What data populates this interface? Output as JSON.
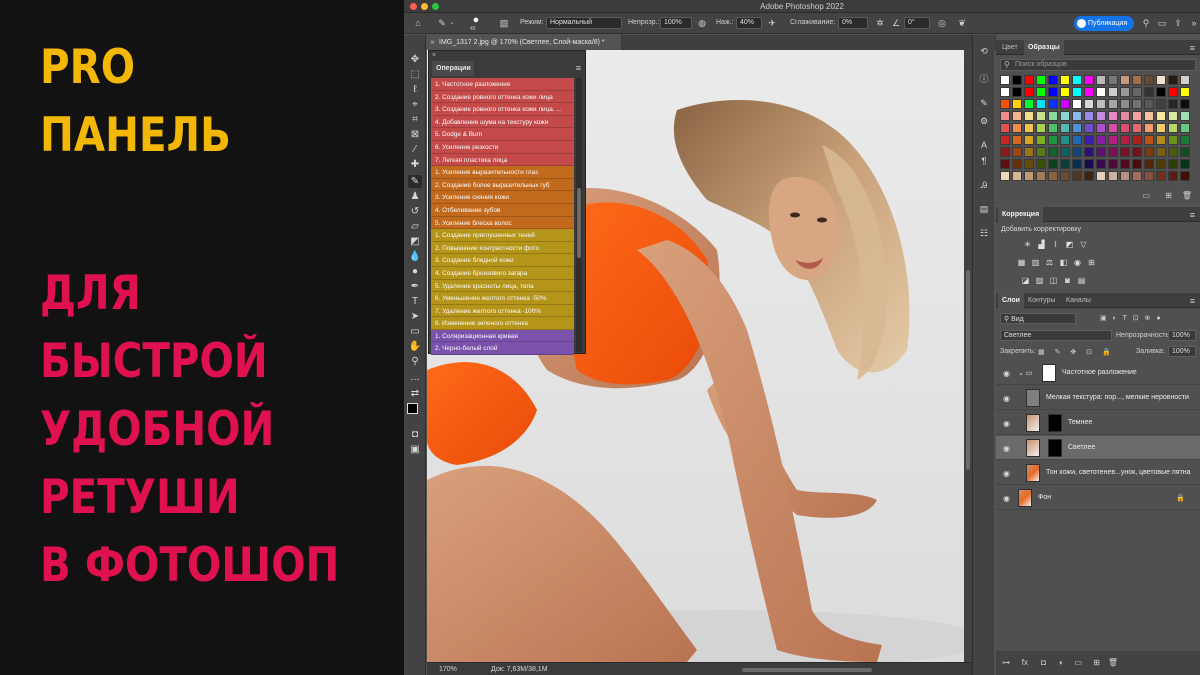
{
  "promo": {
    "line1": "PRO",
    "line2": "ПАНЕЛЬ",
    "line3": "ДЛЯ",
    "line4": "БЫСТРОЙ",
    "line5": "УДОБНОЙ",
    "line6": "РЕТУШИ",
    "line7": "В ФОТОШОП",
    "colors": {
      "yellow": "#f2b707",
      "pink": "#e0114f",
      "background": "#121212"
    }
  },
  "window": {
    "title": "Adobe Photoshop 2022"
  },
  "options_bar": {
    "brush_size": "45",
    "mode_label": "Режим:",
    "mode_value": "Нормальный",
    "opacity_label": "Непрозр.:",
    "opacity_value": "100%",
    "pressure_label": "Наж.:",
    "pressure_value": "40%",
    "smoothing_label": "Сглаживание:",
    "smoothing_value": "0%",
    "angle_value": "0°",
    "publish_label": "Публикация"
  },
  "document": {
    "tab_title": "IMG_1317 2.jpg @ 170% (Светлее, Слой-маска/8) *",
    "zoom": "170%",
    "doc_info": "Док: 7,63M/38,1M"
  },
  "actions_panel": {
    "tab": "Операции",
    "items": [
      {
        "label": "1. Частотное разложение",
        "color": "#c44a4a"
      },
      {
        "label": "2. Создание ровного оттенка кожи лица",
        "color": "#c44a4a"
      },
      {
        "label": "3. Создание ровного оттенка кожи лица. ...",
        "color": "#c44a4a"
      },
      {
        "label": "4. Добавление шума на текстуру кожи",
        "color": "#c44a4a"
      },
      {
        "label": "5. Dodge & Burn",
        "color": "#c44a4a"
      },
      {
        "label": "6. Усиление резкости",
        "color": "#c44a4a"
      },
      {
        "label": "7. Легкая пластика лица",
        "color": "#c44a4a"
      },
      {
        "label": "1. Усиление выразительности глаз",
        "color": "#c1691d"
      },
      {
        "label": "2. Создание более выразительных губ",
        "color": "#c1691d"
      },
      {
        "label": "3. Усиление сияния кожи",
        "color": "#c1691d"
      },
      {
        "label": "4. Отбеливание зубов",
        "color": "#c1691d"
      },
      {
        "label": "5. Усиление блеска волос",
        "color": "#c1691d"
      },
      {
        "label": "1. Создание приглушенных теней",
        "color": "#b49419"
      },
      {
        "label": "2. Повышение контрастности фото",
        "color": "#b49419"
      },
      {
        "label": "3. Создание бледной кожи",
        "color": "#b49419"
      },
      {
        "label": "4. Создание бронзового загара",
        "color": "#b49419"
      },
      {
        "label": "5. Удаление красноты лица, тела",
        "color": "#b49419"
      },
      {
        "label": "6. Уменьшение желтого оттенка -50%",
        "color": "#b49419"
      },
      {
        "label": "7. Удаление желтого оттенка -100%",
        "color": "#b49419"
      },
      {
        "label": "8. Изменение зеленого оттенка",
        "color": "#b49419"
      },
      {
        "label": "1. Соляризационная кривая",
        "color": "#7b52ab"
      },
      {
        "label": "2. Черно-белый слой",
        "color": "#7b52ab"
      }
    ]
  },
  "swatches_panel": {
    "tab_color": "Цвет",
    "tab_swatches": "Образцы",
    "search_placeholder": "Поиск образцов"
  },
  "adjustments_panel": {
    "tab": "Коррекция",
    "subtitle": "Добавить корректировку"
  },
  "layers_panel": {
    "tab_layers": "Слои",
    "tab_contours": "Контуры",
    "tab_channels": "Каналы",
    "filter_value": "Вид",
    "blend_value": "Светлее",
    "opacity_label": "Непрозрачность:",
    "opacity_value": "100%",
    "lock_label": "Закрепить:",
    "fill_label": "Заливка:",
    "fill_value": "100%",
    "layers": [
      {
        "name": "Частотное разложение",
        "kind": "group"
      },
      {
        "name": "Мелкая текстура: пор..., мелкие неровности",
        "kind": "gray"
      },
      {
        "name": "Темнее",
        "kind": "masked"
      },
      {
        "name": "Светлее",
        "kind": "masked",
        "selected": true
      },
      {
        "name": "Тон кожи, светотенев...унок, цветовые пятна",
        "kind": "photo"
      },
      {
        "name": "Фон",
        "kind": "photo",
        "locked": true
      }
    ]
  }
}
